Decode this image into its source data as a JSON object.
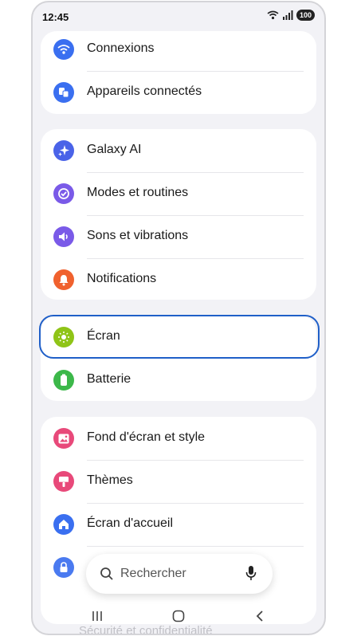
{
  "status_bar": {
    "time": "12:45",
    "battery": "100"
  },
  "groups": [
    {
      "items": [
        {
          "label": "Connexions",
          "icon": "wifi-icon",
          "color": "#3a6ff0"
        },
        {
          "label": "Appareils connectés",
          "icon": "devices-icon",
          "color": "#3a6ff0"
        }
      ]
    },
    {
      "items": [
        {
          "label": "Galaxy AI",
          "icon": "sparkle-icon",
          "color": "#4a63e8"
        },
        {
          "label": "Modes et routines",
          "icon": "check-circle-icon",
          "color": "#7a5ae8"
        },
        {
          "label": "Sons et vibrations",
          "icon": "speaker-icon",
          "color": "#7a5ae8"
        },
        {
          "label": "Notifications",
          "icon": "bell-icon",
          "color": "#f0612e"
        }
      ]
    },
    {
      "items": [
        {
          "label": "Écran",
          "icon": "sun-icon",
          "color": "#8fc417",
          "selected": true
        },
        {
          "label": "Batterie",
          "icon": "battery-icon",
          "color": "#3cb84a"
        }
      ]
    },
    {
      "items": [
        {
          "label": "Fond d'écran et style",
          "icon": "image-icon",
          "color": "#e8497a"
        },
        {
          "label": "Thèmes",
          "icon": "paintbrush-icon",
          "color": "#e8497a"
        },
        {
          "label": "Écran d'accueil",
          "icon": "home-icon",
          "color": "#3a6ff0"
        },
        {
          "label": "",
          "icon": "lock-icon",
          "color": "#4a7af0"
        }
      ]
    }
  ],
  "search": {
    "placeholder": "Rechercher"
  },
  "faded_item": "Sécurité et confidentialité"
}
